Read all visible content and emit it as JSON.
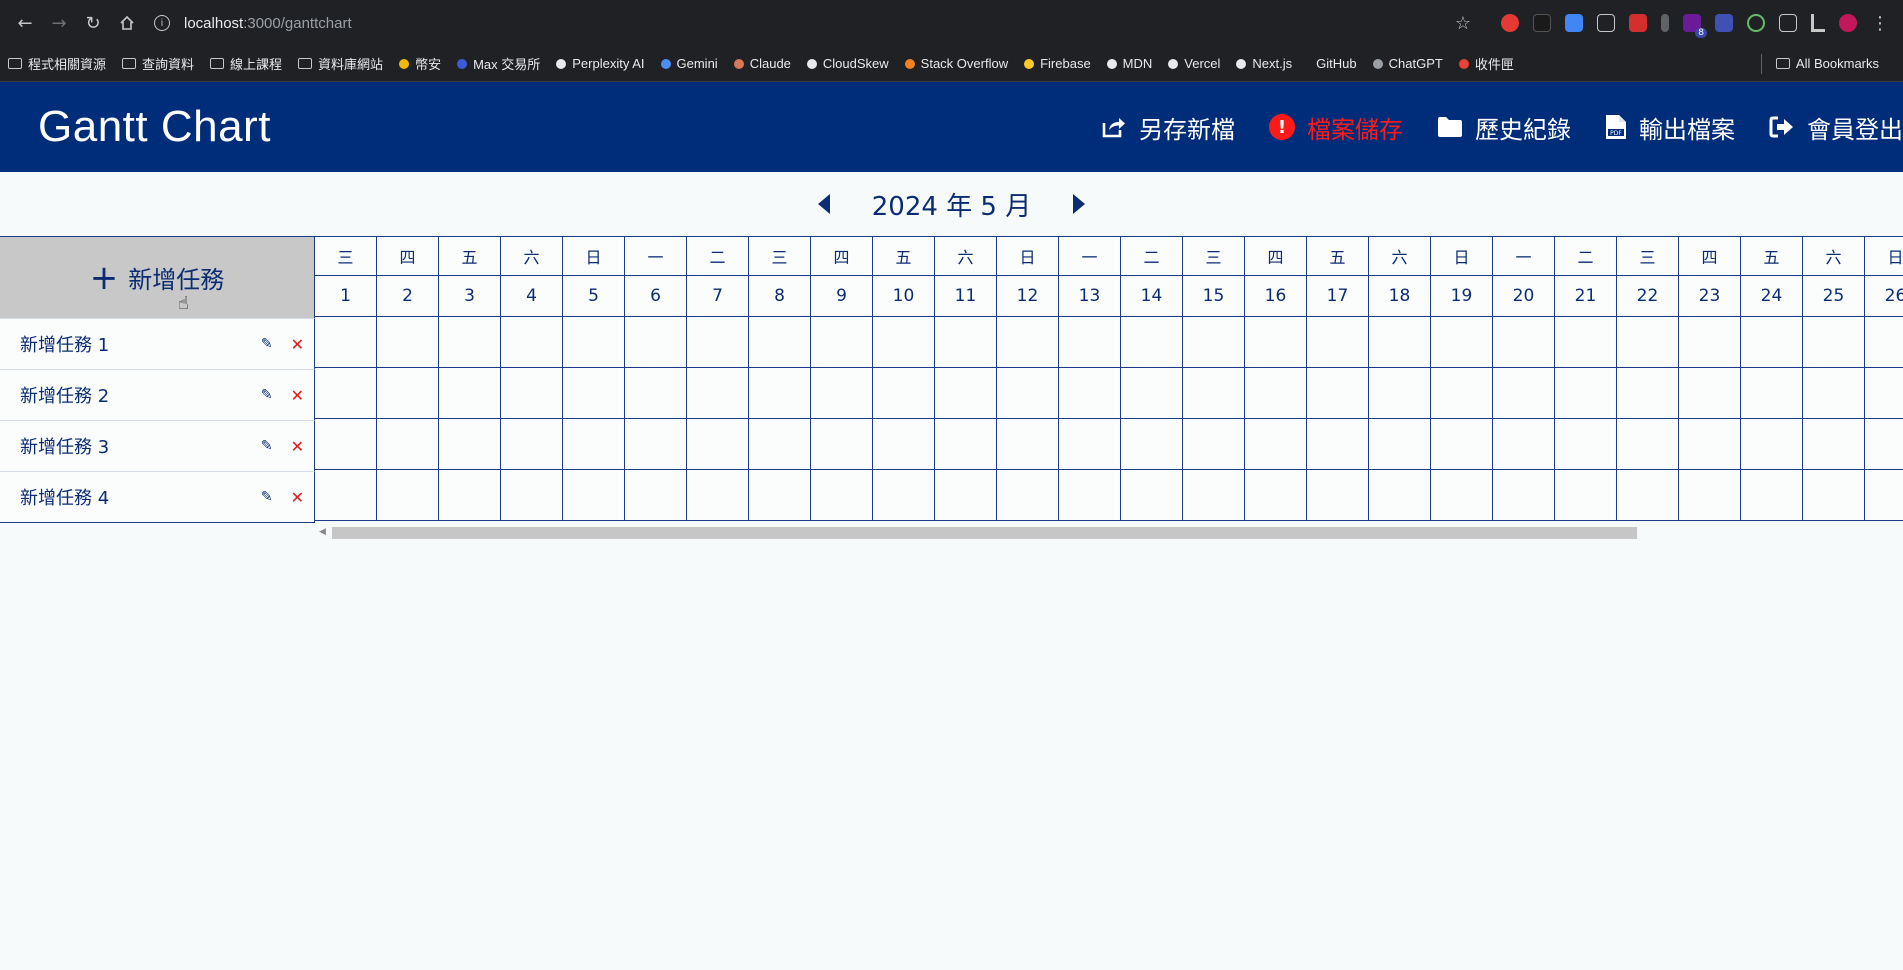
{
  "browser": {
    "url_host": "localhost",
    "url_path": ":3000/ganttchart",
    "bookmarks": [
      {
        "label": "程式相關資源",
        "icon": "folder-icon"
      },
      {
        "label": "查詢資料",
        "icon": "folder-icon"
      },
      {
        "label": "線上課程",
        "icon": "folder-icon"
      },
      {
        "label": "資料庫網站",
        "icon": "folder-icon"
      },
      {
        "label": "幣安",
        "icon": "binance-icon"
      },
      {
        "label": "Max 交易所",
        "icon": "max-icon"
      },
      {
        "label": "Perplexity AI",
        "icon": "perplexity-icon"
      },
      {
        "label": "Gemini",
        "icon": "gemini-icon"
      },
      {
        "label": "Claude",
        "icon": "claude-icon"
      },
      {
        "label": "CloudSkew",
        "icon": "cloudskew-icon"
      },
      {
        "label": "Stack Overflow",
        "icon": "stackoverflow-icon"
      },
      {
        "label": "Firebase",
        "icon": "firebase-icon"
      },
      {
        "label": "MDN",
        "icon": "mdn-icon"
      },
      {
        "label": "Vercel",
        "icon": "vercel-icon"
      },
      {
        "label": "Next.js",
        "icon": "nextjs-icon"
      },
      {
        "label": "GitHub",
        "icon": "github-icon"
      },
      {
        "label": "ChatGPT",
        "icon": "chatgpt-icon"
      },
      {
        "label": "收件匣",
        "icon": "gmail-icon"
      }
    ],
    "all_bookmarks": "All Bookmarks",
    "ext_badge": "8"
  },
  "header": {
    "title": "Gantt Chart",
    "actions": {
      "save_as": "另存新檔",
      "save": "檔案儲存",
      "history": "歷史紀錄",
      "export": "輸出檔案",
      "logout": "會員登出"
    },
    "colors": {
      "bar": "#002d7a",
      "alert": "#ff1a1a"
    }
  },
  "calendar": {
    "month_label": "2024 年 5 月",
    "days": [
      {
        "w": "三",
        "d": "1"
      },
      {
        "w": "四",
        "d": "2"
      },
      {
        "w": "五",
        "d": "3"
      },
      {
        "w": "六",
        "d": "4"
      },
      {
        "w": "日",
        "d": "5"
      },
      {
        "w": "一",
        "d": "6"
      },
      {
        "w": "二",
        "d": "7"
      },
      {
        "w": "三",
        "d": "8"
      },
      {
        "w": "四",
        "d": "9"
      },
      {
        "w": "五",
        "d": "10"
      },
      {
        "w": "六",
        "d": "11"
      },
      {
        "w": "日",
        "d": "12"
      },
      {
        "w": "一",
        "d": "13"
      },
      {
        "w": "二",
        "d": "14"
      },
      {
        "w": "三",
        "d": "15"
      },
      {
        "w": "四",
        "d": "16"
      },
      {
        "w": "五",
        "d": "17"
      },
      {
        "w": "六",
        "d": "18"
      },
      {
        "w": "日",
        "d": "19"
      },
      {
        "w": "一",
        "d": "20"
      },
      {
        "w": "二",
        "d": "21"
      },
      {
        "w": "三",
        "d": "22"
      },
      {
        "w": "四",
        "d": "23"
      },
      {
        "w": "五",
        "d": "24"
      },
      {
        "w": "六",
        "d": "25"
      },
      {
        "w": "日",
        "d": "26"
      }
    ]
  },
  "tasks": {
    "add_label": "新增任務",
    "items": [
      {
        "name": "新增任務 1"
      },
      {
        "name": "新增任務 2"
      },
      {
        "name": "新增任務 3"
      },
      {
        "name": "新增任務 4"
      }
    ]
  }
}
